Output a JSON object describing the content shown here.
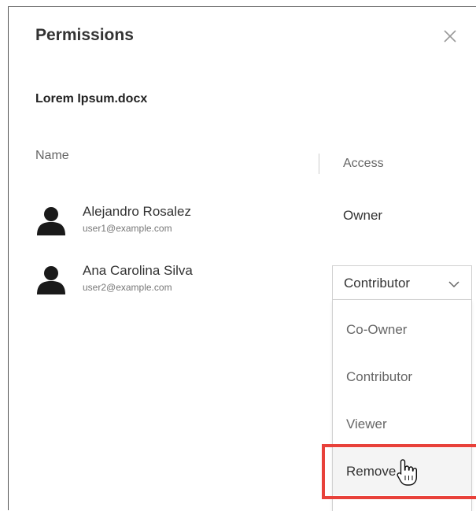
{
  "dialog": {
    "title": "Permissions",
    "close_icon": "close-icon"
  },
  "file": {
    "name": "Lorem Ipsum.docx"
  },
  "columns": {
    "name": "Name",
    "access": "Access"
  },
  "users": [
    {
      "name": "Alejandro Rosalez",
      "email": "user1@example.com",
      "access": "Owner",
      "icon": "user-icon"
    },
    {
      "name": "Ana Carolina Silva",
      "email": "user2@example.com",
      "access": "Contributor",
      "icon": "user-icon"
    }
  ],
  "access_dropdown": {
    "selected": "Contributor",
    "options": [
      "Co-Owner",
      "Contributor",
      "Viewer",
      "Remove"
    ],
    "highlighted": "Remove"
  },
  "colors": {
    "highlight": "#e8413a",
    "text": "#333333",
    "muted": "#666666"
  }
}
